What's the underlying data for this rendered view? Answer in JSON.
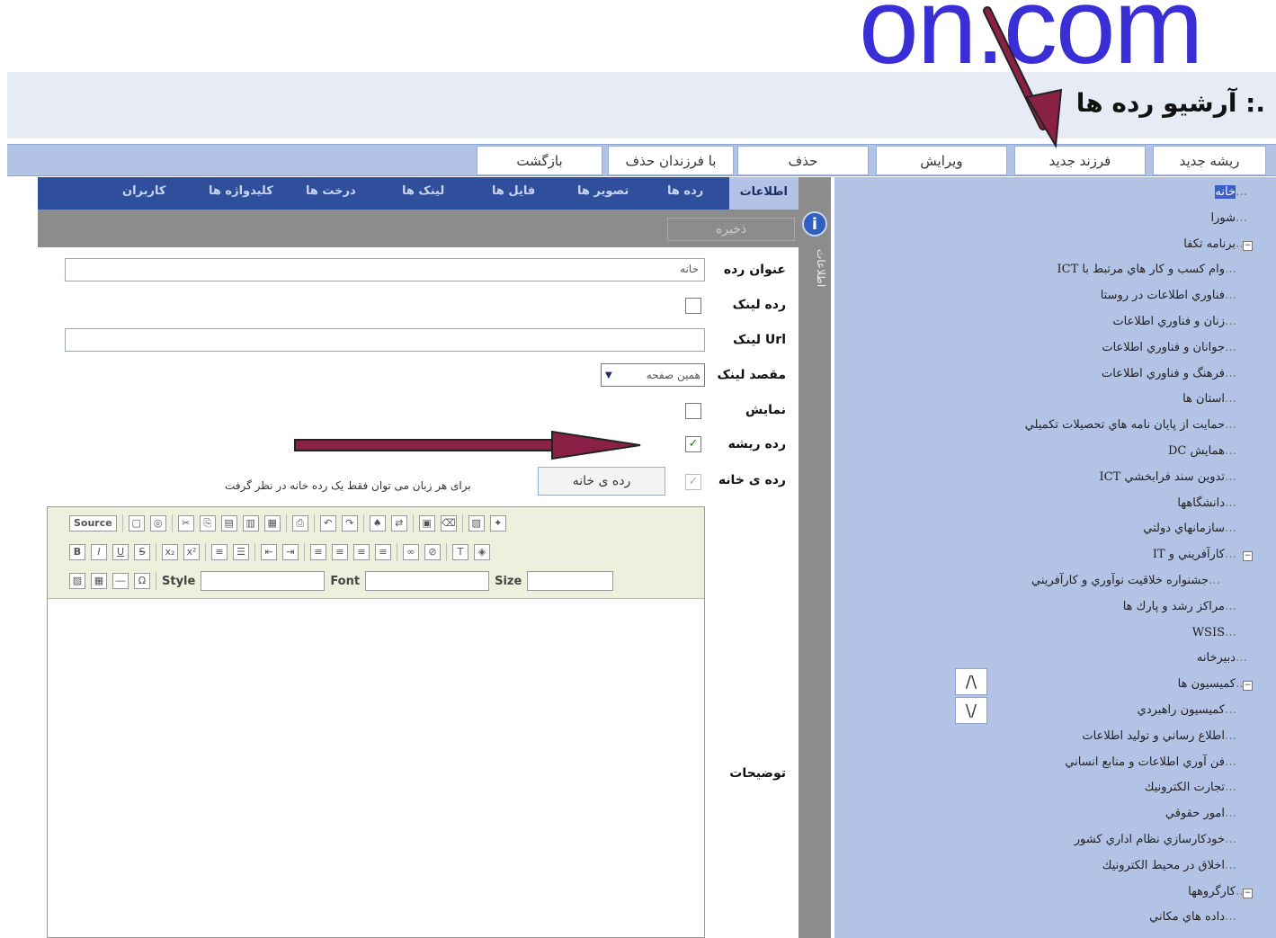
{
  "header": {
    "title": ".: آرشیو رده ها"
  },
  "watermark": "on.com",
  "toolbar": {
    "new_root": "ریشه جدید",
    "new_child": "فرزند جدید",
    "edit": "ویرایش",
    "delete": "حذف",
    "delete_with_children": "با فرزندان حذف",
    "back": "بازگشت"
  },
  "tabs": [
    "اطلاعات",
    "رده ها",
    "تصویر ها",
    "فایل ها",
    "لینک ها",
    "درخت ها",
    "کلیدواژه ها",
    "کاربران"
  ],
  "side": {
    "label": "اطلاعات"
  },
  "save_label": "ذخیره",
  "form": {
    "title_label": "عنوان رده",
    "title_value": "خانه",
    "link_label": "رده لینک",
    "url_label": "Url لینک",
    "target_label": "مقصد لینک",
    "target_value": "همین صفحه",
    "display_label": "نمایش",
    "root_label": "رده ریشه",
    "home_label": "رده ی خانه",
    "home_button": "رده ی خانه",
    "home_hint": "برای هر زبان می توان فقط یک رده خانه در نظر گرفت",
    "desc_label": "توضیحات"
  },
  "editor": {
    "source": "Source",
    "style": "Style",
    "font": "Font",
    "size": "Size"
  },
  "tree": [
    "خانه",
    "شورا",
    "برنامه تكفا",
    "وام كسب و كار هاي مرتبط با ICT",
    "فناوري اطلاعات در روستا",
    "زنان و فناوري اطلاعات",
    "جوانان و فناوري اطلاعات",
    "فرهنگ و فناوري اطلاعات",
    "استان ها",
    "حمايت از پايان نامه هاي تحصيلات تكميلي",
    "همايش DC",
    "تدوين سند فرابخشي ICT",
    "دانشگاهها",
    "سازمانهاي دولتي",
    "كارآفريني و IT",
    "جشنواره خلاقيت نوآوري و كارآفريني",
    "مراكز رشد و پارك ها",
    "WSIS",
    "دبيرخانه",
    "كميسيون ها",
    "كميسيون راهبردي",
    "اطلاع رساني و توليد اطلاعات",
    "فن آوري اطلاعات و منابع انساني",
    "تجارت الكترونيك",
    "امور حقوقي",
    "خودكارسازي نظام اداري كشور",
    "اخلاق در محيط الكترونيك",
    "كارگروهها",
    "داده هاي مكاني"
  ],
  "scroll": {
    "up": "/\\",
    "down": "\\/"
  },
  "colors": {
    "panel": "#b3c3e6",
    "tabs": "#2f4e9c",
    "arrow": "#8a2045"
  }
}
